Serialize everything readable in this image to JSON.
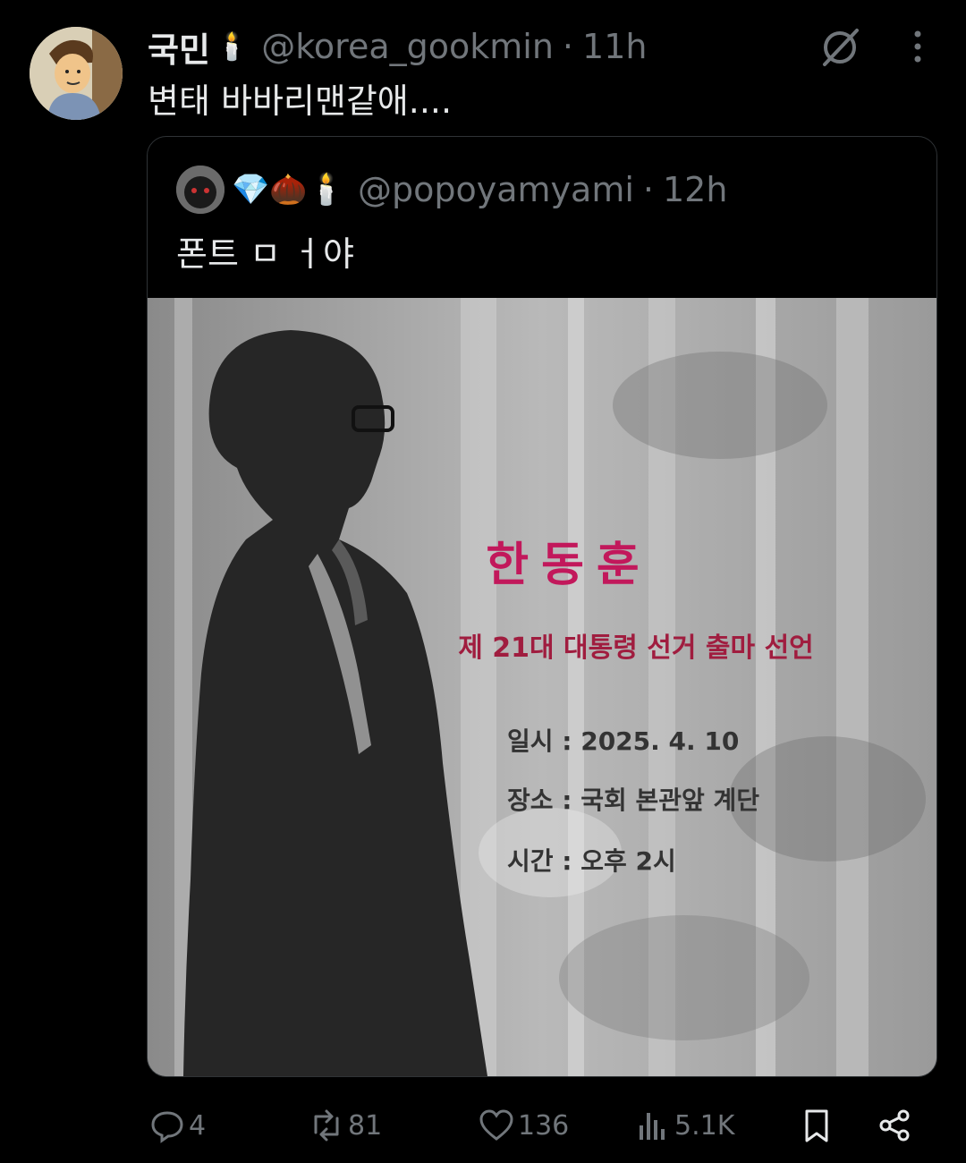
{
  "tweet": {
    "display_name": "국민",
    "name_badge": "🕯️",
    "handle": "@korea_gookmin",
    "separator": "·",
    "time": "11h",
    "text": "변태 바바리맨같애....",
    "grok_icon": "grok-icon",
    "more_icon": "more-icon"
  },
  "quote": {
    "badges": "💎🌰🕯️",
    "handle": "@popoyamyami",
    "separator": "·",
    "time": "12h",
    "text": "폰트 ㅁ ㅓ야"
  },
  "poster": {
    "name": "한동훈",
    "subtitle": "제 21대 대통령 선거 출마 선언",
    "line1": "일시 : 2025. 4. 10",
    "line2": "장소 : 국회 본관앞 계단",
    "line3": "시간 : 오후 2시",
    "name_color": "#c2185b",
    "subtitle_color": "#a01d3f"
  },
  "actions": {
    "replies": "4",
    "retweets": "81",
    "likes": "136",
    "views": "5.1K"
  }
}
